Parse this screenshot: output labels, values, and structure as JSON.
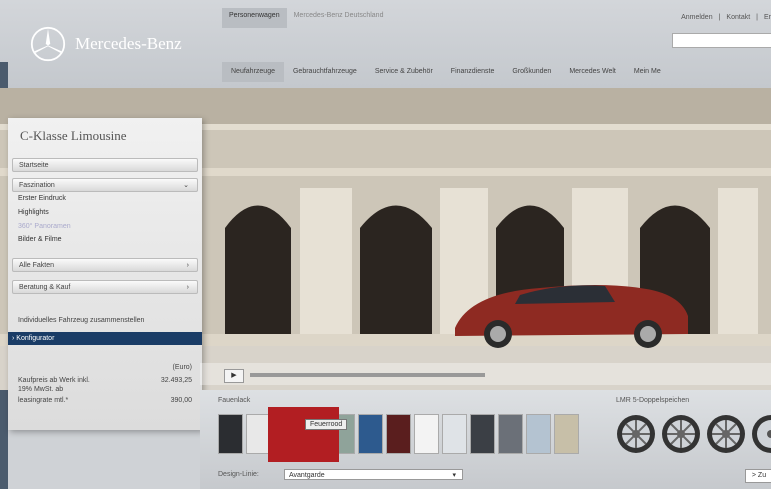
{
  "header": {
    "brand": "Mercedes-Benz",
    "top_tabs": [
      "Personenwagen",
      "Mercedes-Benz Deutschland"
    ],
    "utility": [
      "Anmelden",
      "|",
      "Kontakt",
      "|",
      "Er"
    ],
    "nav": [
      "Neufahrzeuge",
      "Gebrauchtfahrzeuge",
      "Service & Zubehör",
      "Finanzdienste",
      "Großkunden",
      "Mercedes Welt",
      "Mein Me"
    ]
  },
  "panel": {
    "title": "C-Klasse Limousine",
    "startseite": "Startseite",
    "faszination": "Faszination",
    "faszination_items": [
      "Erster Eindruck",
      "Highlights",
      "360° Panoramen",
      "Bilder & Filme"
    ],
    "alle_fakten": "Alle Fakten",
    "beratung": "Beratung & Kauf",
    "individuelles": "Individuelles Fahrzeug zusammenstellen",
    "konfigurator": "› Konfigurator",
    "price": {
      "currency": "(Euro)",
      "line1": "Kaufpreis ab Werk inkl.",
      "line2": "19% MwSt. ab",
      "value1": "32.493,25",
      "line3": "leasingrate mtl.*",
      "value3": "390,00"
    }
  },
  "player": {
    "play": "▶"
  },
  "config": {
    "paint_label": "Fauenlack",
    "tooltip": "Feuerrood",
    "rims_label": "LMR 5-Doppelspeichen",
    "design_label": "Design-Linie:",
    "design_value": "Avantgarde",
    "next": "> Zu",
    "swatch_colors": [
      "#2b2d31",
      "#e8e8e8",
      "#b21e22",
      "#8fa39a",
      "#2d5a8e",
      "#5a1e1e",
      "#f3f3f3",
      "#dfe3e7",
      "#3b3f45",
      "#6b7078",
      "#b4c3d1",
      "#c7bfa8"
    ]
  }
}
